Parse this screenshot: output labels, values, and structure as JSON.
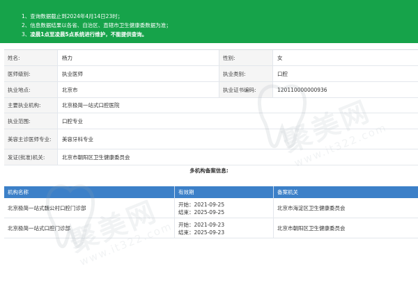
{
  "notice": {
    "lines": [
      {
        "num": "1、",
        "text": "查询数据截止到2024年4月14日23时；"
      },
      {
        "num": "2、",
        "text": "信息数据结果以各省、自治区、直辖市卫生健康委数据为准；"
      },
      {
        "num": "3、",
        "text": "凌晨1点至凌晨5点系统进行维护，不能提供查询。"
      }
    ]
  },
  "info": {
    "name_label": "姓名:",
    "name_value": "杨力",
    "gender_label": "性别:",
    "gender_value": "女",
    "level_label": "医师级别:",
    "level_value": "执业医师",
    "category_label": "执业类别:",
    "category_value": "口腔",
    "location_label": "执业地点:",
    "location_value": "北京市",
    "cert_label": "执业证书编码:",
    "cert_value": "120110000000936",
    "org_label": "主要执业机构:",
    "org_value": "北京极简一站式口腔医院",
    "scope_label": "执业范围:",
    "scope_value": "口腔专业",
    "cosmetic_label": "美容主诊医师专业:",
    "cosmetic_value": "美容牙科专业",
    "issuer_label": "发证(批准)机关:",
    "issuer_value": "北京市朝阳区卫生健康委员会"
  },
  "multi": {
    "title": "多机构备案信息:",
    "headers": {
      "org": "机构名称",
      "validity": "有效期",
      "agency": "备案机关"
    },
    "rows": [
      {
        "org": "北京极简一站式魏公村口腔门诊部",
        "start": "开始：2021-09-25",
        "end": "结束：2025-09-25",
        "agency": "北京市海淀区卫生健康委员会"
      },
      {
        "org": "北京极简一站式口腔门诊部",
        "start": "开始：2021-09-23",
        "end": "结束：2025-09-23",
        "agency": "北京市朝阳区卫生健康委员会"
      }
    ]
  },
  "watermark": {
    "brand": "聚美网",
    "url": "www.it322.com"
  },
  "colors": {
    "notice_bg": "#16a34a",
    "table_header_bg": "#3c80c8",
    "label_bg": "#f5f5f5"
  }
}
